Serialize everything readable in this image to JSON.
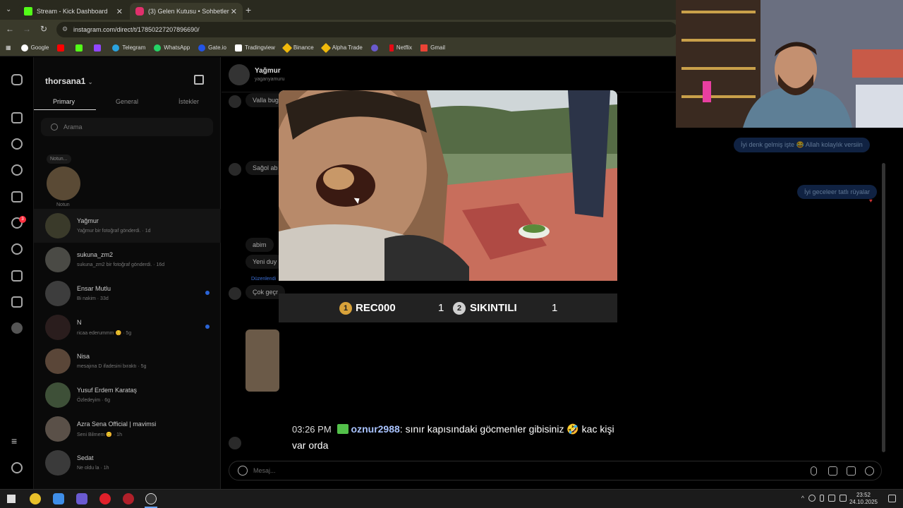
{
  "browser": {
    "tabs": [
      {
        "title": "Stream - Kick Dashboard",
        "color": "#53fc18"
      },
      {
        "title": "(3) Gelen Kutusu • Sohbetler",
        "color": "#e1306c"
      }
    ],
    "url": "instagram.com/direct/t/17850227207896690/",
    "bookmarks": [
      "Google",
      "",
      "",
      "",
      "Telegram",
      "WhatsApp",
      "Gate.io",
      "Tradingview",
      "Binance",
      "Alpha Trade",
      "",
      "Netflix",
      "Gmail"
    ]
  },
  "inbox": {
    "username": "thorsana1",
    "tabs": [
      "Primary",
      "General",
      "İstekler"
    ],
    "search_placeholder": "Arama",
    "note_bubble": "Notun...",
    "note_label": "Notun",
    "rail_badge": "3",
    "conversations": [
      {
        "name": "Yağmur",
        "preview": "Yağmur bir fotoğraf gönderdi. · 1d",
        "unread": false,
        "color": "#3a3a2a"
      },
      {
        "name": "sukuna_zm2",
        "preview": "sukuna_zm2 bir fotoğraf gönderdi. · 16d",
        "unread": false,
        "color": "#4a4a45"
      },
      {
        "name": "Ensar Mutlu",
        "preview": "Bi nakim · 33d",
        "unread": true,
        "color": "#3d3d3d"
      },
      {
        "name": "N",
        "preview": "ricaa ederummm 😊 · 5g",
        "unread": true,
        "color": "#2a1d1d"
      },
      {
        "name": "Nisa",
        "preview": "mesajına D ifadesini bıraktı · 5g",
        "unread": false,
        "color": "#5a4638"
      },
      {
        "name": "Yusuf Erdem Karataş",
        "preview": "Özledeyim · 6g",
        "unread": false,
        "color": "#3e5038"
      },
      {
        "name": "Azra Sena Official | mavimsi",
        "preview": "Seni Bilmem 😊 · 1h",
        "unread": false,
        "color": "#5a5048"
      },
      {
        "name": "Sedat",
        "preview": "Ne oldu la · 1h",
        "unread": false,
        "color": "#3a3a3a"
      }
    ]
  },
  "thread": {
    "name": "Yağmur",
    "handle": "yaganyamuru",
    "messages_left": [
      "Valla bug",
      "Sağol ab",
      "abim",
      "Yeni duy",
      "Çok geçr"
    ],
    "edited_label": "Düzenlendi",
    "messages_right": [
      "İyi denk gelmiş işte 😂 Allah kolaylık versiin",
      "İyi geceleer tatlı rüyalar"
    ],
    "composer_placeholder": "Mesaj..."
  },
  "overlay": {
    "scoreboard": {
      "left_name": "REC000",
      "left_score": "1",
      "right_name": "SIKINTILI",
      "right_score": "1",
      "left_badge": "1",
      "right_badge": "2"
    },
    "chat": {
      "time": "03:26 PM",
      "user": "oznur2988",
      "message": ": sınır kapısındaki göcmenler gibisiniz 🤣 kac kişi var orda"
    }
  },
  "taskbar": {
    "time": "23:52",
    "date": "24.10.2025"
  }
}
